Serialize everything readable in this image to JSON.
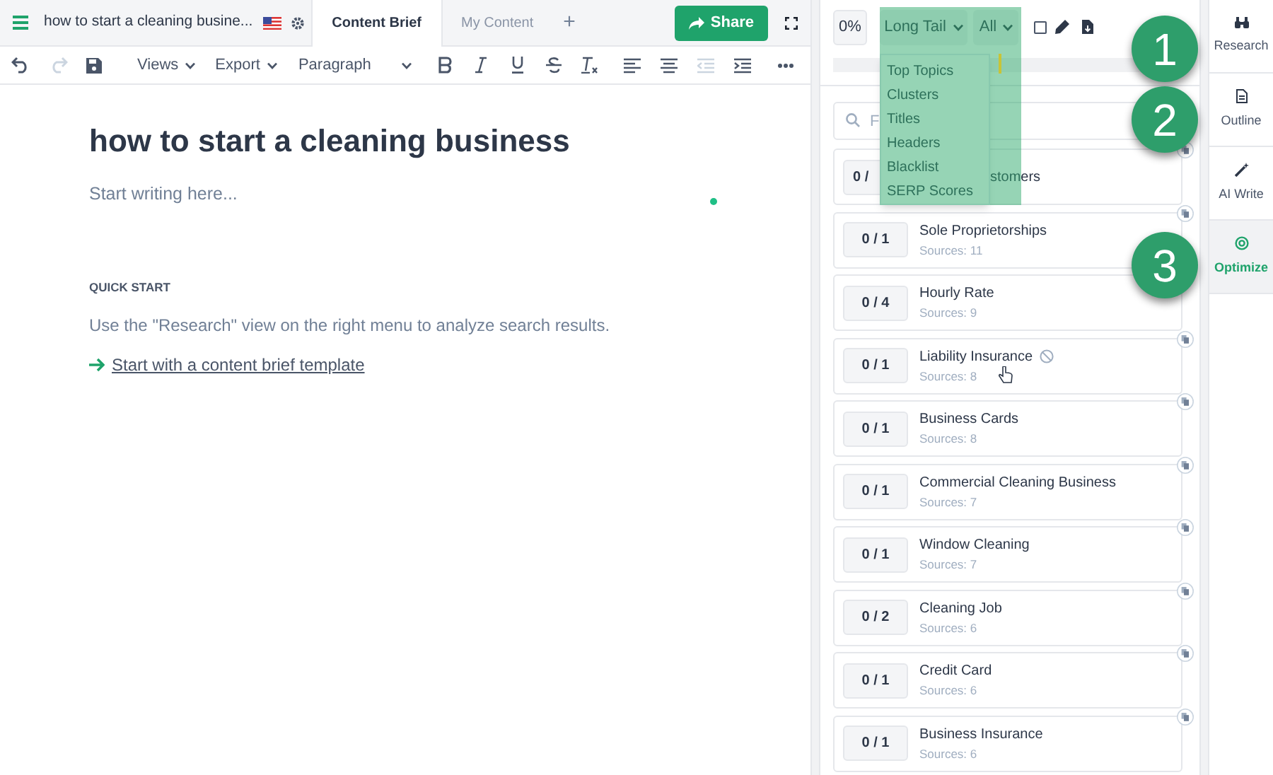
{
  "header": {
    "doc_title": "how to start a cleaning busine...",
    "tabs": [
      {
        "label": "Content Brief",
        "selected": true
      },
      {
        "label": "My Content",
        "selected": false
      }
    ],
    "add_tab": "+",
    "share": "Share"
  },
  "toolbar": {
    "views": "Views",
    "export": "Export",
    "block_format": "Paragraph"
  },
  "editor": {
    "title": "how to start a cleaning business",
    "placeholder": "Start writing here...",
    "section_heading": "QUICK START",
    "hint": "Use the \"Research\" view on the right menu to analyze search results.",
    "link": "Start with a content brief template"
  },
  "panel": {
    "score": "0%",
    "filter_type": "Long Tail",
    "filter_scope": "All",
    "checkbox_checked": false,
    "search_placeholder": "F",
    "menu": [
      "Top Topics",
      "Clusters",
      "Titles",
      "Headers",
      "Blacklist",
      "SERP Scores"
    ],
    "topics": [
      {
        "count": "0 /",
        "name": "stomers",
        "hover": false
      },
      {
        "count": "0 / 1",
        "name": "Sole Proprietorships",
        "sources": "Sources: 11",
        "hover": false
      },
      {
        "count": "0 / 4",
        "name": "Hourly Rate",
        "sources": "Sources: 9",
        "hover": false
      },
      {
        "count": "0 / 1",
        "name": "Liability Insurance",
        "sources": "Sources: 8",
        "hover": true
      },
      {
        "count": "0 / 1",
        "name": "Business Cards",
        "sources": "Sources: 8",
        "hover": false
      },
      {
        "count": "0 / 1",
        "name": "Commercial Cleaning Business",
        "sources": "Sources: 7",
        "hover": false
      },
      {
        "count": "0 / 1",
        "name": "Window Cleaning",
        "sources": "Sources: 7",
        "hover": false
      },
      {
        "count": "0 / 2",
        "name": "Cleaning Job",
        "sources": "Sources: 6",
        "hover": false
      },
      {
        "count": "0 / 1",
        "name": "Credit Card",
        "sources": "Sources: 6",
        "hover": false
      },
      {
        "count": "0 / 1",
        "name": "Business Insurance",
        "sources": "Sources: 6",
        "hover": false
      }
    ]
  },
  "sidebar": [
    {
      "label": "Research",
      "kind": "research",
      "selected": false
    },
    {
      "label": "Outline",
      "kind": "outline",
      "selected": false
    },
    {
      "label": "AI Write",
      "kind": "write",
      "selected": false
    },
    {
      "label": "Optimize",
      "kind": "optimize",
      "selected": true
    }
  ],
  "callouts": [
    "1",
    "2",
    "3"
  ]
}
